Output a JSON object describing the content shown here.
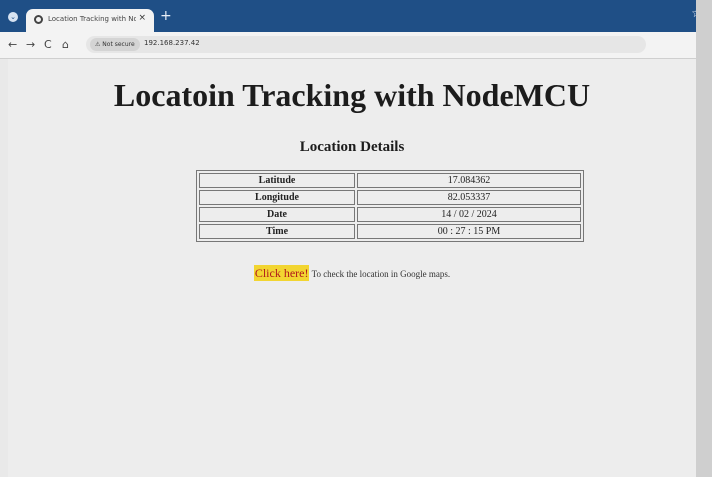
{
  "browser": {
    "tab_title": "Location Tracking with NodeMC",
    "tab_close": "×",
    "new_tab": "+",
    "bookmark_icon": "☆",
    "window_menu_icon": "⌄",
    "back_icon": "←",
    "forward_icon": "→",
    "reload_icon": "C",
    "home_icon": "⌂",
    "security_label": "⚠ Not secure",
    "url": "192.168.237.42"
  },
  "page": {
    "title": "Locatoin Tracking with NodeMCU",
    "subtitle": "Location Details",
    "rows": [
      {
        "label": "Latitude",
        "value": "17.084362"
      },
      {
        "label": "Longitude",
        "value": "82.053337"
      },
      {
        "label": "Date",
        "value": "14 / 02 / 2024"
      },
      {
        "label": "Time",
        "value": "00 : 27 : 15 PM"
      }
    ],
    "link_text": "Click here!",
    "link_suffix": " To check the location in Google maps."
  },
  "colors": {
    "tabbar": "#1f4f86",
    "link_highlight": "#f2d531",
    "link_text": "#b0191b"
  }
}
